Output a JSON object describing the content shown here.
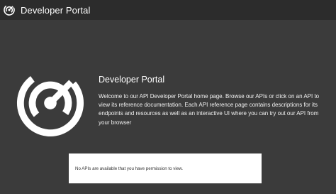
{
  "header": {
    "logo_icon": "portal-logo-icon",
    "title": "Developer Portal"
  },
  "hero": {
    "logo_icon": "portal-logo-icon",
    "title": "Developer Portal",
    "description": "Welcome to our API Developer Portal home page. Browse our APIs or click on an API to view its reference documentation. Each API reference page contains descriptions for its endpoints and resources as well as an interactive UI where you can try out our API from your browser"
  },
  "notice": {
    "message": "No APIs are available that you have permission to view."
  },
  "colors": {
    "topbar": "#2c2c2c",
    "background": "#3b3b3b",
    "text": "#ffffff",
    "panel": "#ffffff"
  }
}
